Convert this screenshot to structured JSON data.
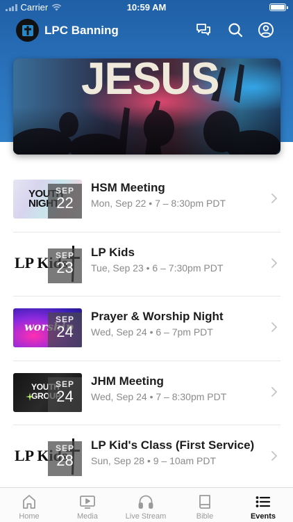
{
  "status_bar": {
    "carrier": "Carrier",
    "time": "10:59 AM"
  },
  "app": {
    "title": "LPC Banning"
  },
  "banner": {
    "text": "JESUS"
  },
  "events": [
    {
      "title": "HSM Meeting",
      "subtitle": "Mon, Sep 22 • 7 – 8:30pm PDT",
      "month": "SEP",
      "day": "22",
      "thumb_text": "YOUTH NIGHT"
    },
    {
      "title": "LP Kids",
      "subtitle": "Tue, Sep 23 • 6 – 7:30pm PDT",
      "month": "SEP",
      "day": "23",
      "thumb_text": "LP Kids"
    },
    {
      "title": "Prayer & Worship Night",
      "subtitle": "Wed, Sep 24 • 6 – 7pm PDT",
      "month": "SEP",
      "day": "24",
      "thumb_text": "worship"
    },
    {
      "title": "JHM Meeting",
      "subtitle": "Wed, Sep 24 • 7 – 8:30pm PDT",
      "month": "SEP",
      "day": "24",
      "thumb_text": "YOUTH GROUP"
    },
    {
      "title": "LP Kid's Class (First Service)",
      "subtitle": "Sun, Sep 28 • 9 – 10am PDT",
      "month": "SEP",
      "day": "28",
      "thumb_text": "LP Kids"
    }
  ],
  "tabs": [
    {
      "label": "Home",
      "icon": "home-icon",
      "active": false
    },
    {
      "label": "Media",
      "icon": "media-icon",
      "active": false
    },
    {
      "label": "Live Stream",
      "icon": "headphones-icon",
      "active": false
    },
    {
      "label": "Bible",
      "icon": "book-icon",
      "active": false
    },
    {
      "label": "Events",
      "icon": "list-icon",
      "active": true
    }
  ],
  "colors": {
    "header_blue": "#2a73bd",
    "active_tab": "#111111",
    "inactive_tab": "#9a9a9a"
  }
}
